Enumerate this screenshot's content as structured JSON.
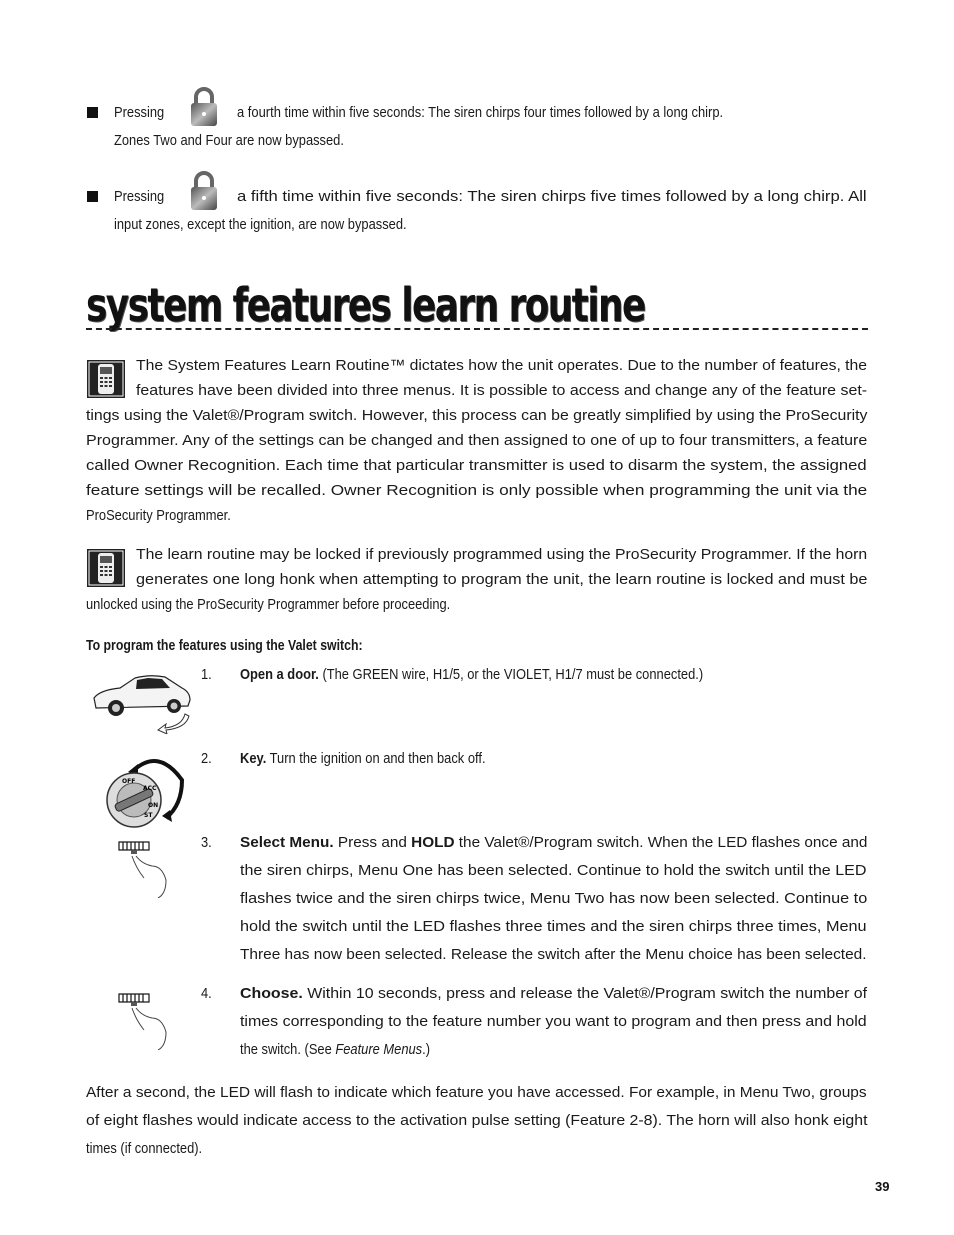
{
  "bullets": [
    {
      "lead": "Pressing",
      "icon": "padlock-icon",
      "line1": "a fourth time within five seconds: The siren chirps four times followed by a long chirp.",
      "line2": "Zones Two and Four are now bypassed."
    },
    {
      "lead": "Pressing",
      "icon": "padlock-icon",
      "line1": "a fifth time within five seconds: The siren chirps five times followed by a long chirp. All",
      "line2": "input zones, except the ignition, are now bypassed."
    }
  ],
  "section": {
    "title": "system features learn routine"
  },
  "paragraphs": [
    {
      "icon": "programmer-icon",
      "lines": [
        "The System Features Learn Routine™ dictates how the unit operates. Due to the number of features, the",
        "features have been divided into three menus. It is possible to access and change any of the feature set-",
        "tings using the Valet®/Program switch. However, this process can be greatly simplified by using the ProSecurity",
        "Programmer. Any of the settings can be changed and then assigned to one of up to four transmitters, a feature",
        "called Owner Recognition. Each time that particular transmitter is used to disarm the system, the assigned",
        "feature settings will be recalled. Owner Recognition is only possible when programming the unit via the",
        "ProSecurity Programmer."
      ]
    },
    {
      "icon": "programmer-icon",
      "lines": [
        "The learn routine may be locked if previously programmed using the ProSecurity Programmer. If the horn",
        "generates one long honk when attempting to program the unit, the learn routine is locked and must be",
        "unlocked using the ProSecurity Programmer before proceeding."
      ]
    }
  ],
  "subheading": "To program the features using the Valet switch:",
  "steps": [
    {
      "number": "1.",
      "icon": "car-door-icon",
      "bold": "Open a door.",
      "lines": [
        "(The GREEN wire, H1/5, or the VIOLET, H1/7 must be connected.)"
      ]
    },
    {
      "number": "2.",
      "icon": "ignition-key-icon",
      "bold": "Key.",
      "lines": [
        "Turn the ignition on and then back off."
      ],
      "icon_labels": [
        "OFF",
        "ACC",
        "ON",
        "ST"
      ]
    },
    {
      "number": "3.",
      "icon": "valet-switch-press-icon",
      "bold": "Select Menu.",
      "bold2": "HOLD",
      "first_pre": "Press and",
      "first_post": "the Valet®/Program switch. When the LED flashes once and",
      "lines": [
        "the siren chirps, Menu One has been selected. Continue to hold the switch until the LED",
        "flashes twice and the siren chirps twice, Menu Two has now been selected. Continue to",
        "hold the switch until the LED flashes three times and the siren chirps three times, Menu",
        "Three has now been selected. Release the switch after the Menu choice has been selected."
      ]
    },
    {
      "number": "4.",
      "icon": "valet-switch-press-icon",
      "bold": "Choose.",
      "first_post": "Within 10 seconds, press and release the Valet®/Program switch the number of",
      "lines": [
        "times corresponding to the feature number you want to program and then press and hold",
        "the switch. (See"
      ],
      "italic": "Feature Menus",
      "tail": ".)"
    }
  ],
  "closing": [
    "After a second, the LED will flash to indicate which feature you have accessed. For example, in Menu Two, groups",
    "of eight flashes would indicate access to the activation pulse setting (Feature 2-8). The horn will also honk eight",
    "times (if connected)."
  ],
  "page_number": "39"
}
